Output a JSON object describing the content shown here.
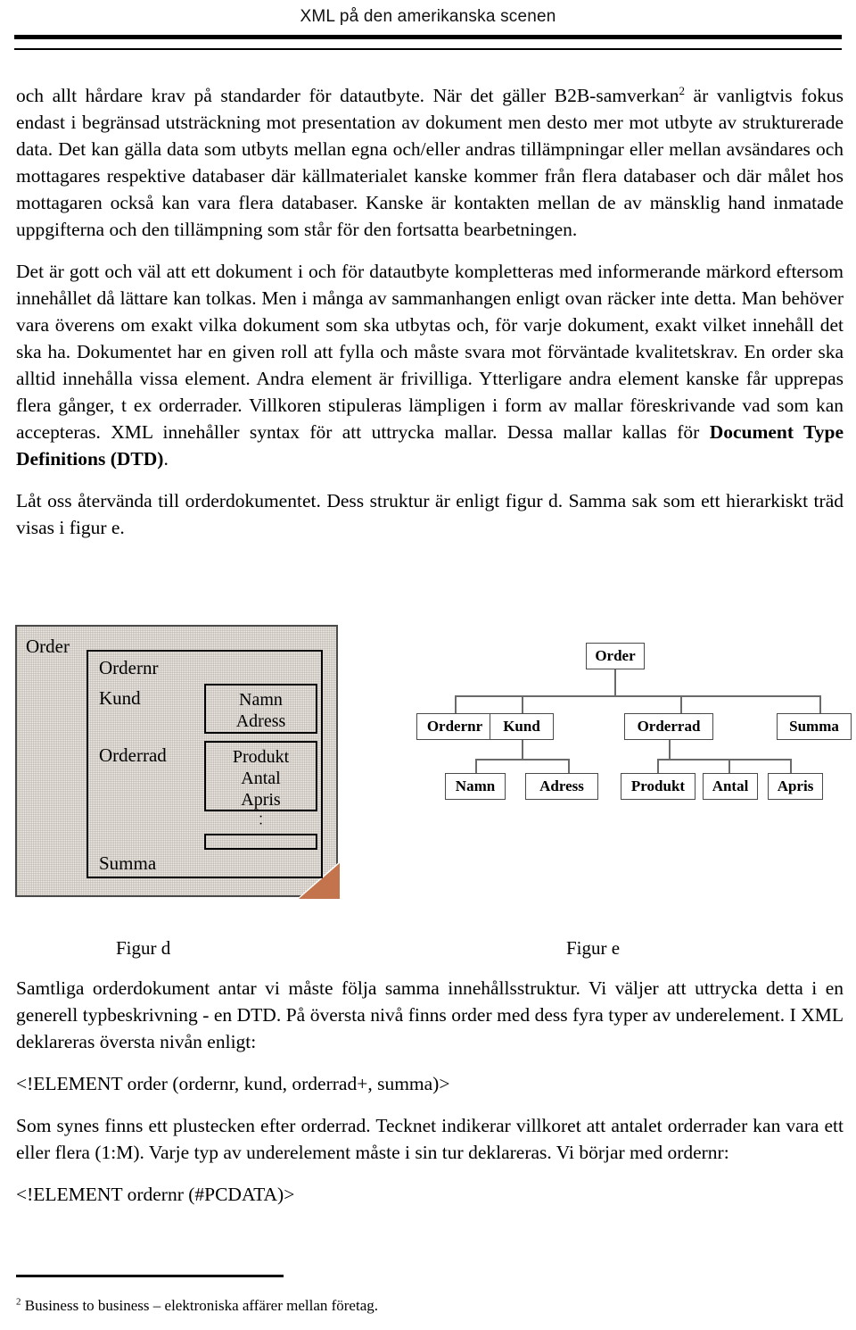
{
  "header": {
    "title": "XML på den amerikanska scenen"
  },
  "body": {
    "para1_a": "och allt hårdare krav på standarder för datautbyte. När det gäller B2B-samverkan",
    "para1_sup": "2",
    "para1_b": " är vanligtvis fokus endast i begränsad utsträckning mot presentation av dokument men desto mer mot utbyte av strukturerade data. Det kan gälla data som utbyts mellan egna och/eller andras tillämpningar eller mellan avsändares och mottagares respektive databaser där källmaterialet kanske kommer från flera databaser och där målet hos mottagaren också kan vara flera databaser. Kanske är kontakten mellan de av mänsklig hand inmatade uppgifterna och den tillämpning som står för den fortsatta bearbetningen.",
    "para2_a": "Det är gott och väl att ett dokument i och för datautbyte kompletteras med informerande märkord eftersom innehållet då lättare kan tolkas. Men i många av sammanhangen enligt ovan räcker inte detta. Man behöver vara överens om exakt vilka dokument som ska utbytas och, för varje dokument, exakt vilket innehåll det ska ha. Dokumentet har en given roll att fylla och måste svara mot förväntade kvalitetskrav. En order ska alltid innehålla vissa element. Andra element är frivilliga. Ytterligare andra element kanske får upprepas flera gånger, t ex orderrader. Villkoren stipuleras lämpligen i form av mallar föreskrivande vad som kan accepteras. XML innehåller syntax för att uttrycka mallar. Dessa mallar kallas för ",
    "para2_bold": "Document Type Definitions (DTD)",
    "para2_b": ".",
    "para3": "Låt oss återvända till orderdokumentet. Dess struktur är enligt figur d. Samma sak som ett hierarkiskt träd visas i figur e.",
    "para4": "Samtliga orderdokument antar vi måste följa samma innehållsstruktur. Vi väljer att uttrycka detta i en generell typbeskrivning - en DTD. På översta nivå finns order med dess fyra typer av underelement. I XML deklareras översta nivån enligt:",
    "code1": "<!ELEMENT order (ordernr, kund, orderrad+, summa)>",
    "para5": "Som synes finns ett plustecken efter orderrad. Tecknet indikerar villkoret att antalet orderrader kan vara ett eller flera (1:M). Varje typ av underelement måste i sin tur deklareras. Vi börjar med ordernr:",
    "code2": "<!ELEMENT ordernr (#PCDATA)>"
  },
  "figure_d": {
    "caption": "Figur d",
    "outer_label": "Order",
    "labels": {
      "ordernr": "Ordernr",
      "kund": "Kund",
      "orderrad": "Orderrad",
      "summa": "Summa"
    },
    "kund_box": {
      "line1": "Namn",
      "line2": "Adress"
    },
    "orderrad_box": {
      "line1": "Produkt",
      "line2": "Antal",
      "line3": "Apris"
    },
    "ellipsis": "·",
    "empty_box": "",
    "colors": {
      "sheet_fill": "#efece7",
      "corner_fold": "#c4744c",
      "border": "#000000"
    }
  },
  "figure_e": {
    "caption": "Figur e",
    "nodes": {
      "root": "Order",
      "level2": [
        "Ordernr",
        "Kund",
        "Orderrad",
        "Summa"
      ],
      "kund_children": [
        "Namn",
        "Adress"
      ],
      "orderrad_children": [
        "Produkt",
        "Antal",
        "Apris"
      ]
    },
    "colors": {
      "node_fill": "#ffffff",
      "node_border": "#4a4a4a",
      "edge": "#6a6a6a"
    }
  },
  "footnote": {
    "marker": "2",
    "text": " Business to business – elektroniska affärer mellan företag."
  }
}
